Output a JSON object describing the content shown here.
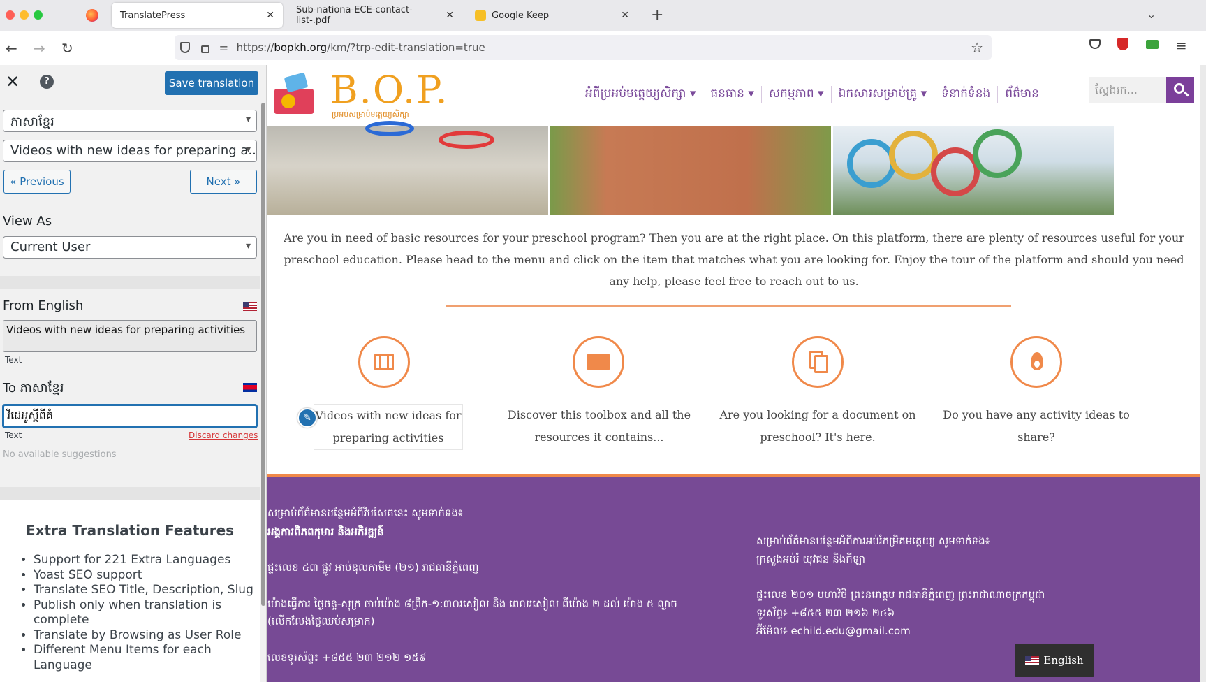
{
  "browser": {
    "tabs": [
      {
        "title": "TranslatePress",
        "active": true
      },
      {
        "title": "Sub-nationa-ECE-contact-list-.pdf",
        "active": false
      },
      {
        "title": "Google Keep",
        "active": false
      }
    ],
    "url_prefix": "https://",
    "url_domain": "bopkh.org",
    "url_rest": "/km/?trp-edit-translation=true"
  },
  "panel": {
    "save_label": "Save translation",
    "language_select": "ភាសាខ្មែរ",
    "string_select": "Videos with new ideas for preparing a...",
    "previous_label": "« Previous",
    "next_label": "Next »",
    "view_as_label": "View As",
    "view_as_value": "Current User",
    "from_label": "From English",
    "from_text": "Videos with new ideas for preparing activities",
    "from_type": "Text",
    "to_label": "To ភាសាខ្មែរ",
    "to_text": "វីដេអូស្តីពីគំ",
    "to_type": "Text",
    "discard_label": "Discard changes",
    "suggestions": "No available suggestions",
    "extra_title": "Extra Translation Features",
    "extra_items": [
      "Support for 221 Extra Languages",
      "Yoast SEO support",
      "Translate SEO Title, Description, Slug",
      "Publish only when translation is complete",
      "Translate by Browsing as User Role",
      "Different Menu Items for each Language"
    ]
  },
  "site": {
    "logo": "B.O.P.",
    "logo_sub": "ប្រអប់សម្រាប់មត្តេយ្យសិក្សា",
    "menu": [
      "អំពីប្រអប់មត្តេយ្យសិក្សា ▾",
      "ធនធាន ▾",
      "សកម្មភាព ▾",
      "ឯកសារសម្រាប់គ្រូ ▾",
      "ទំនាក់ទំនង",
      "ព័ត៌មាន"
    ],
    "search_placeholder": "ស្វែងរក...",
    "intro": "Are you in need of basic resources for your preschool program? Then you are at the right place. On this platform, there are plenty of resources useful for your preschool education. Please head to the menu and click on the item that matches what you are looking for. Enjoy the tour of the platform and should you need any help, please feel free to reach out to us.",
    "features": [
      {
        "icon": "film-icon",
        "text": "Videos with new ideas for preparing activities"
      },
      {
        "icon": "box-icon",
        "text": "Discover this toolbox and all the resources it contains..."
      },
      {
        "icon": "document-icon",
        "text": "Are you looking for a document on preschool? It's here."
      },
      {
        "icon": "flame-icon",
        "text": "Do you have any activity ideas to share?"
      }
    ],
    "footer_left": [
      "សម្រាប់ព័ត៌មានបន្ថែមអំពីវិបសៃតនេះ សូមទាក់ទង៖",
      "អង្គការពិភពកុមារ និងអភិវឌ្ឍន៍",
      "ផ្ទះលេខ ៤៣ ផ្លូវ អាប់ឌុលកាមីម (២១) រាជធានីភ្នំពេញ",
      "ម៉ោងធ្វើការ ថ្ងៃចន្ទ-សុក្រ ចាប់ម៉ោង ៨ព្រឹក-១:៣០រសៀល និង ពេលរសៀល ពីម៉ោង ២ ដល់ ម៉ោង ៥ ល្ងាច",
      "(លើកលែងថ្ងៃឈប់សម្រាក)",
      "លេខទូរស័ព្ទ៖ +៨៥៥ ២៣ ២១២ ១៥៩"
    ],
    "footer_right": [
      "សម្រាប់ព័ត៌មានបន្ថែមអំពីការអប់រំកម្រិតមត្តេយ្យ សូមទាក់ទង៖",
      "ក្រសួងអប់រំ យុវជន និងកីឡា",
      "ផ្ទះលេខ ២០១ មហាវិថី ព្រះនរោត្តម រាជធានីភ្នំពេញ ព្រះរាជាណាចក្រកម្ពុជា",
      "ទូរស័ព្ទ៖ +៨៥៥ ២៣ ២១៦ ២៤៦",
      "អ៊ីម៉ែល៖ echild.edu@gmail.com"
    ],
    "language_switcher": "English"
  },
  "colors": {
    "accent_blue": "#2271b1",
    "brand_purple": "#774a95",
    "brand_orange": "#f0894a"
  }
}
